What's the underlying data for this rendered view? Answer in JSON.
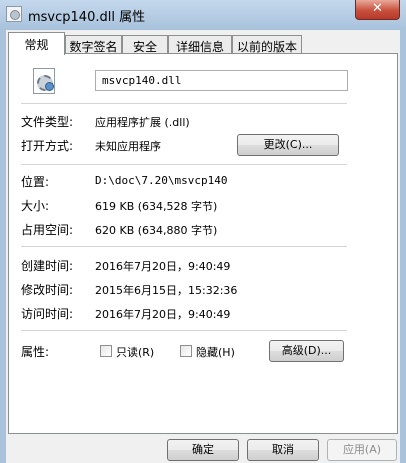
{
  "window": {
    "title": "msvcp140.dll 属性",
    "close_glyph": "✕",
    "icon": "dll-file-icon"
  },
  "tabs": [
    {
      "label": "常规",
      "active": true
    },
    {
      "label": "数字签名",
      "active": false
    },
    {
      "label": "安全",
      "active": false
    },
    {
      "label": "详细信息",
      "active": false
    },
    {
      "label": "以前的版本",
      "active": false
    }
  ],
  "general": {
    "file_name": "msvcp140.dll",
    "file_type_label": "文件类型:",
    "file_type_value": "应用程序扩展 (.dll)",
    "opens_with_label": "打开方式:",
    "opens_with_value": "未知应用程序",
    "change_button": "更改(C)...",
    "location_label": "位置:",
    "location_value": "D:\\doc\\7.20\\msvcp140",
    "size_label": "大小:",
    "size_value": "619 KB (634,528 字节)",
    "size_on_disk_label": "占用空间:",
    "size_on_disk_value": "620 KB (634,880 字节)",
    "created_label": "创建时间:",
    "created_value": "2016年7月20日，9:40:49",
    "modified_label": "修改时间:",
    "modified_value": "2015年6月15日，15:32:36",
    "accessed_label": "访问时间:",
    "accessed_value": "2016年7月20日，9:40:49",
    "attributes_label": "属性:",
    "readonly_label": "只读(R)",
    "readonly_checked": false,
    "hidden_label": "隐藏(H)",
    "hidden_checked": false,
    "advanced_button": "高级(D)..."
  },
  "footer": {
    "ok": "确定",
    "cancel": "取消",
    "apply": "应用(A)",
    "apply_enabled": false
  }
}
